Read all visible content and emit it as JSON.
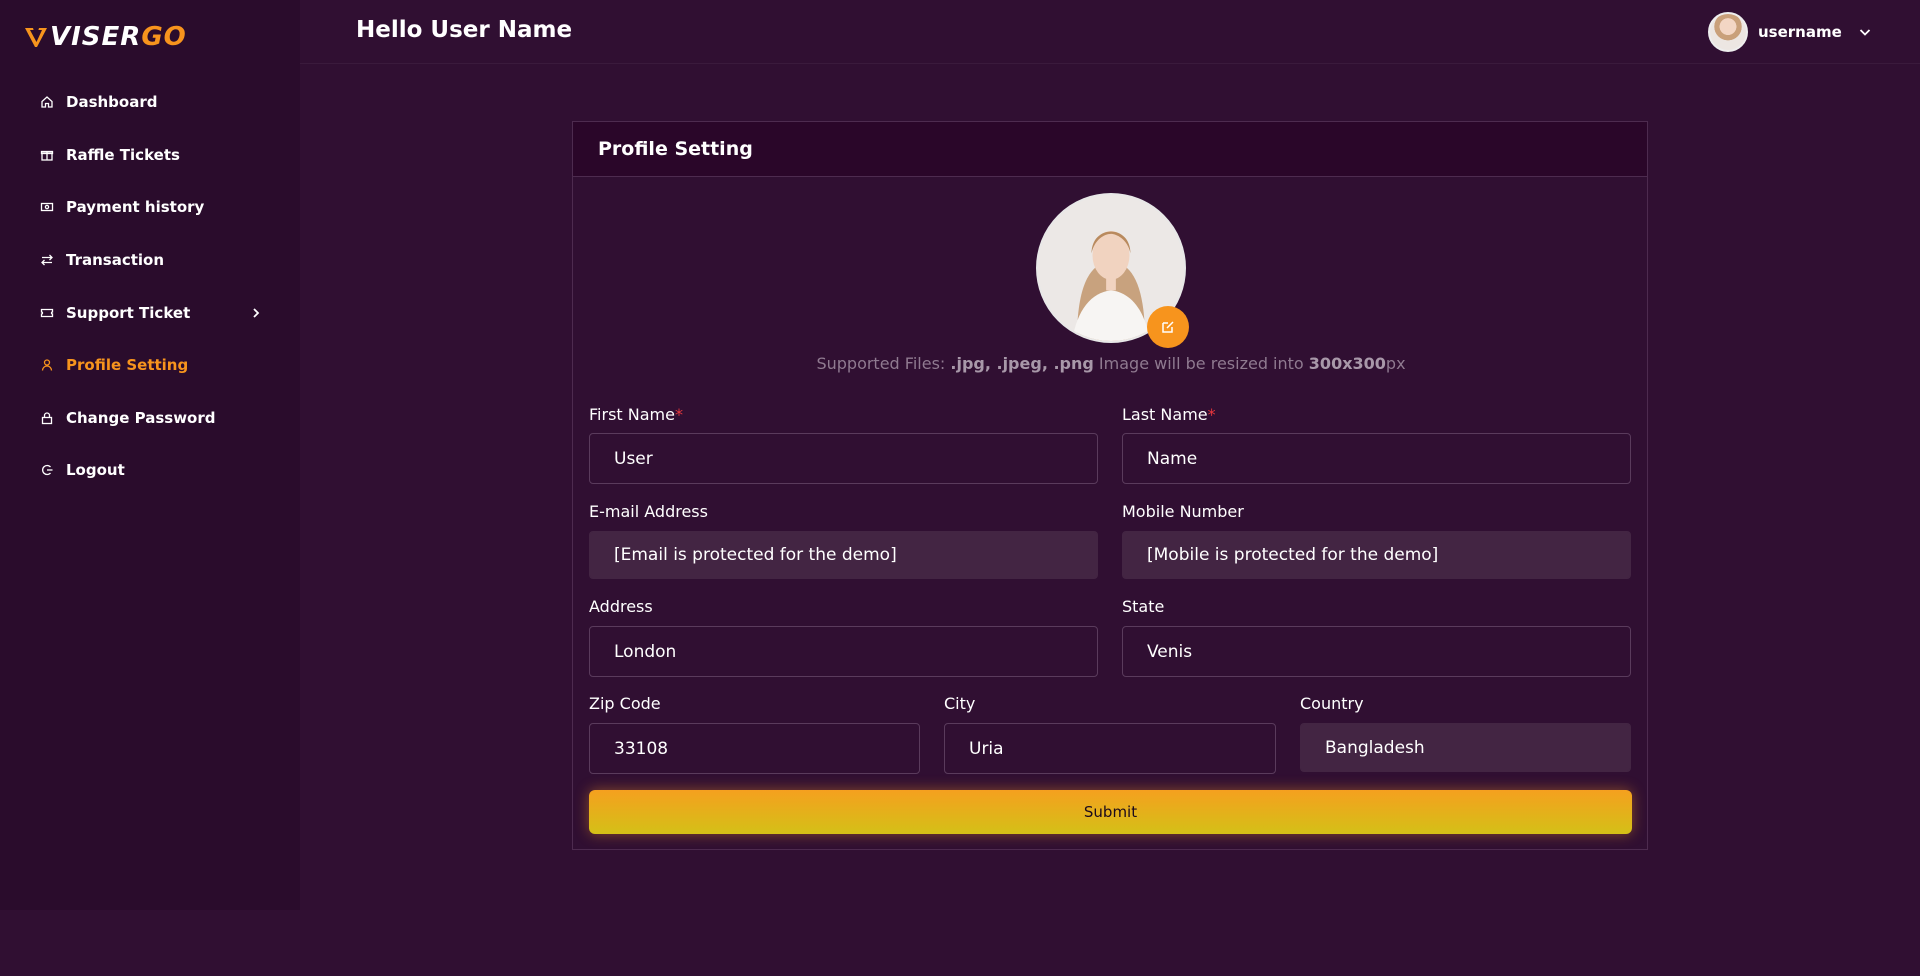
{
  "brand": {
    "logo_white": "VISER",
    "logo_orange": "GO"
  },
  "header": {
    "greeting": "Hello User Name",
    "username": "username"
  },
  "sidebar": {
    "items": [
      {
        "label": "Dashboard",
        "icon": "home-icon",
        "active": false
      },
      {
        "label": "Raffle Tickets",
        "icon": "gift-icon",
        "active": false
      },
      {
        "label": "Payment history",
        "icon": "money-icon",
        "active": false
      },
      {
        "label": "Transaction",
        "icon": "exchange-icon",
        "active": false
      },
      {
        "label": "Support Ticket",
        "icon": "ticket-icon",
        "active": false,
        "has_submenu": true
      },
      {
        "label": "Profile Setting",
        "icon": "user-icon",
        "active": true
      },
      {
        "label": "Change Password",
        "icon": "lock-icon",
        "active": false
      },
      {
        "label": "Logout",
        "icon": "logout-icon",
        "active": false
      }
    ]
  },
  "card": {
    "title": "Profile Setting",
    "supported_prefix": "Supported Files: ",
    "supported_types": ".jpg, .jpeg, .png",
    "supported_mid": " Image will be resized into ",
    "supported_size": "300x300",
    "supported_unit": "px"
  },
  "form": {
    "first_name": {
      "label": "First Name",
      "required_mark": "*",
      "value": "User"
    },
    "last_name": {
      "label": "Last Name",
      "required_mark": "*",
      "value": "Name"
    },
    "email": {
      "label": "E-mail Address",
      "value": "[Email is protected for the demo]"
    },
    "mobile": {
      "label": "Mobile Number",
      "value": "[Mobile is protected for the demo]"
    },
    "address": {
      "label": "Address",
      "value": "London"
    },
    "state": {
      "label": "State",
      "value": "Venis"
    },
    "zip": {
      "label": "Zip Code",
      "value": "33108"
    },
    "city": {
      "label": "City",
      "value": "Uria"
    },
    "country": {
      "label": "Country",
      "value": "Bangladesh"
    },
    "submit_label": "Submit"
  },
  "colors": {
    "background": "#300f32",
    "sidebar": "#2a0c2c",
    "accent": "#f7941d",
    "required": "#e8383d",
    "readonly_field": "#432543"
  }
}
